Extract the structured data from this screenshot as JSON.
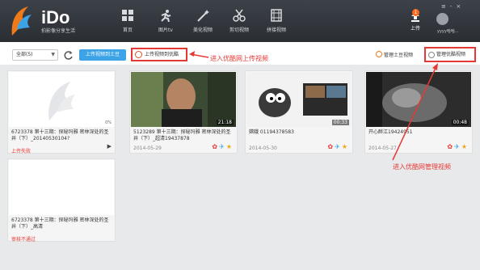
{
  "app": {
    "name": "iDo",
    "slogan": "拍影像分享生活"
  },
  "nav": [
    {
      "label": "首页",
      "icon": "home-grid-icon"
    },
    {
      "label": "图片tv",
      "icon": "runner-icon"
    },
    {
      "label": "美化视频",
      "icon": "magic-wand-icon"
    },
    {
      "label": "剪切视频",
      "icon": "scissors-icon"
    },
    {
      "label": "拼接视频",
      "icon": "film-strip-icon"
    }
  ],
  "upload": {
    "label": "上传",
    "badge": "1"
  },
  "user": {
    "name": "yyyy哈哈..."
  },
  "toolbar": {
    "filter_value": "全部(5)",
    "upload_tudou": "上传视频到土豆",
    "upload_youku": "上传视频到优酷",
    "manage_tudou": "管理土豆视频",
    "manage_youku": "管理优酷视频"
  },
  "annotations": {
    "upload_note": "进入优酷网上传视频",
    "manage_note": "进入优酷网管理视频"
  },
  "videos": [
    {
      "title": "6723378 第十三期：探秘玛雅 密林深处的圣井（下）_20140530104?",
      "status": "上传失败",
      "progress": "0%",
      "duration": "",
      "date": ""
    },
    {
      "title": "5123289 第十三期：探秘玛雅 密林深处的圣井（下）_超清19437878",
      "status": "",
      "progress": "",
      "duration": "21:18",
      "date": "2014-05-29"
    },
    {
      "title": "嫦娥 01194378583",
      "status": "",
      "progress": "",
      "duration": "00:33",
      "date": "2014-05-30"
    },
    {
      "title": "开心醉江19424951",
      "status": "",
      "progress": "",
      "duration": "00:48",
      "date": "2014-05-27"
    },
    {
      "title": "6723378 第十三期：探秘玛雅 密林深处的圣井（下）_高清",
      "status": "审核不通过",
      "progress": "",
      "duration": "",
      "date": ""
    }
  ],
  "colors": {
    "header_bg": "#33383e",
    "accent_blue": "#3ba3e6",
    "annotation_red": "#e53935"
  }
}
